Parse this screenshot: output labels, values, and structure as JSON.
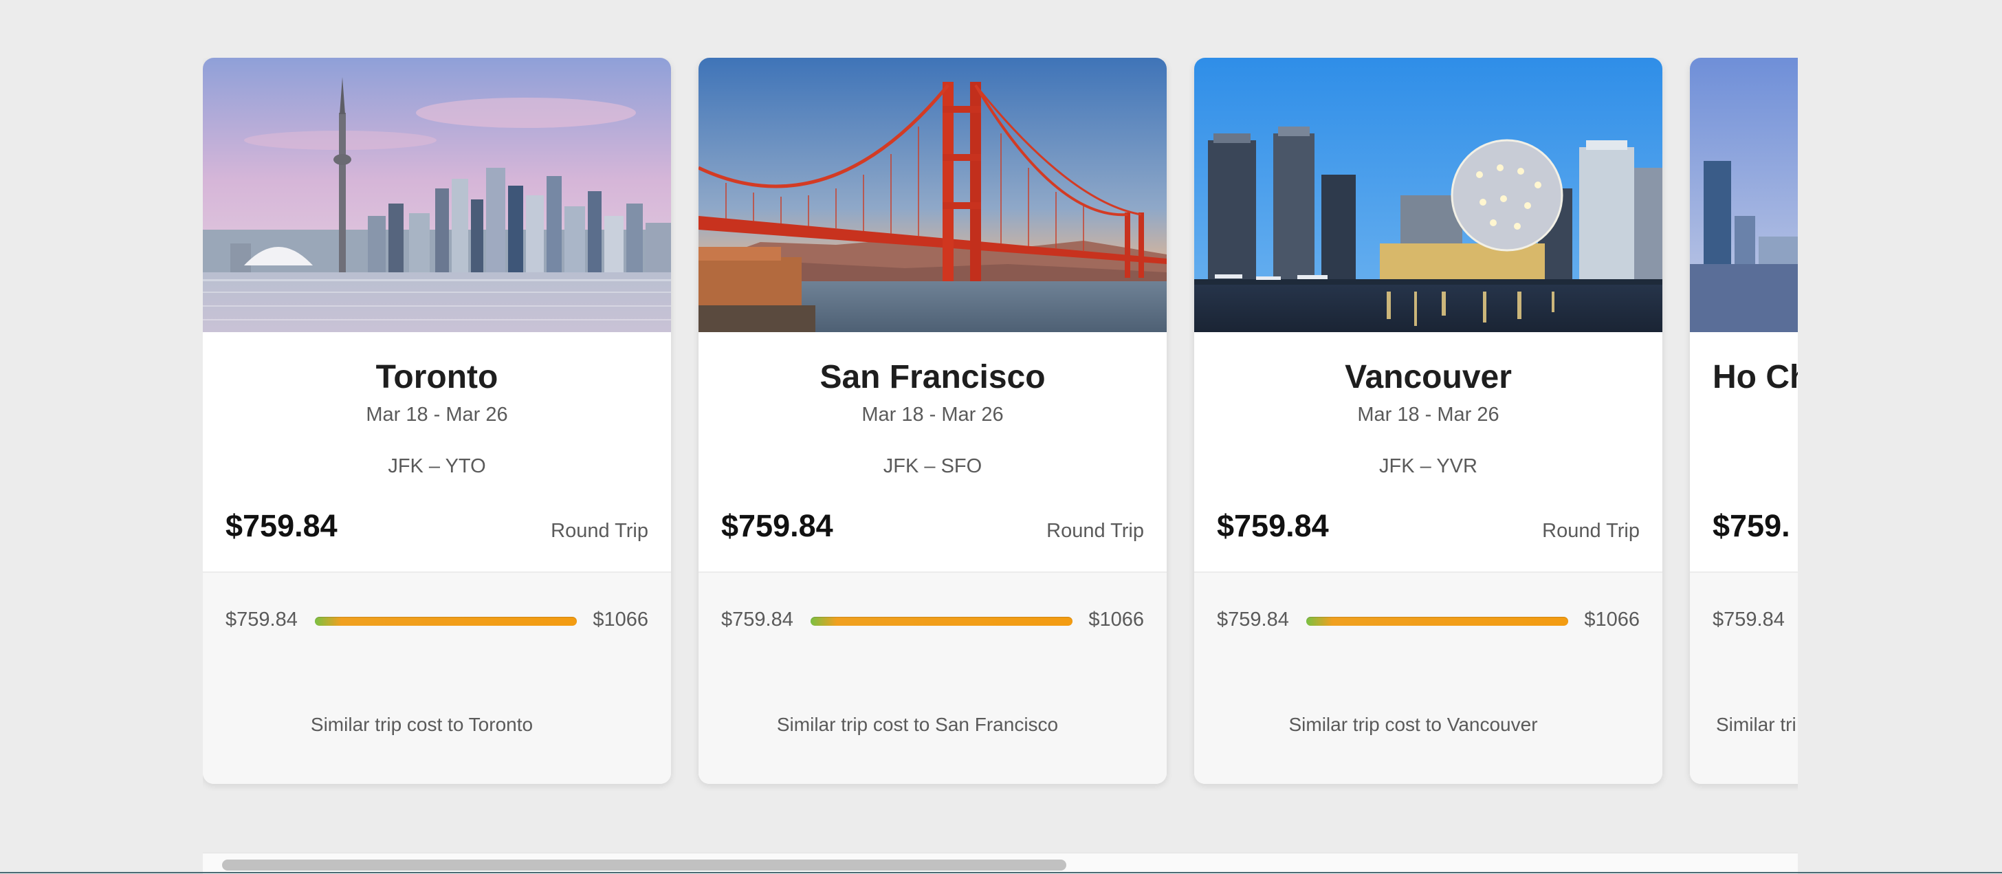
{
  "cards": [
    {
      "city": "Toronto",
      "dates": "Mar 18 - Mar 26",
      "route": "JFK – YTO",
      "price": "$759.84",
      "trip_type": "Round Trip",
      "range_low": "$759.84",
      "range_high": "$1066",
      "similar": "Similar trip cost to Toronto",
      "image": "toronto-skyline"
    },
    {
      "city": "San Francisco",
      "dates": "Mar 18 - Mar 26",
      "route": "JFK – SFO",
      "price": "$759.84",
      "trip_type": "Round Trip",
      "range_low": "$759.84",
      "range_high": "$1066",
      "similar": "Similar trip cost to San Francisco",
      "image": "golden-gate-bridge"
    },
    {
      "city": "Vancouver",
      "dates": "Mar 18 - Mar 26",
      "route": "JFK – YVR",
      "price": "$759.84",
      "trip_type": "Round Trip",
      "range_low": "$759.84",
      "range_high": "$1066",
      "similar": "Similar trip cost to Vancouver",
      "image": "vancouver-science-world"
    },
    {
      "city": "Ho Ch",
      "price": "$759.",
      "range_low": "$759.84",
      "similar": "Similar tri",
      "image": "ho-chi-minh-skyline"
    }
  ],
  "colors": {
    "page_background": "#ececec",
    "card_background": "#ffffff",
    "card_footer_background": "#f7f7f7",
    "range_bar_start": "#7bc043",
    "range_bar_end": "#f39c12",
    "scroll_thumb": "#c1c1c1"
  }
}
